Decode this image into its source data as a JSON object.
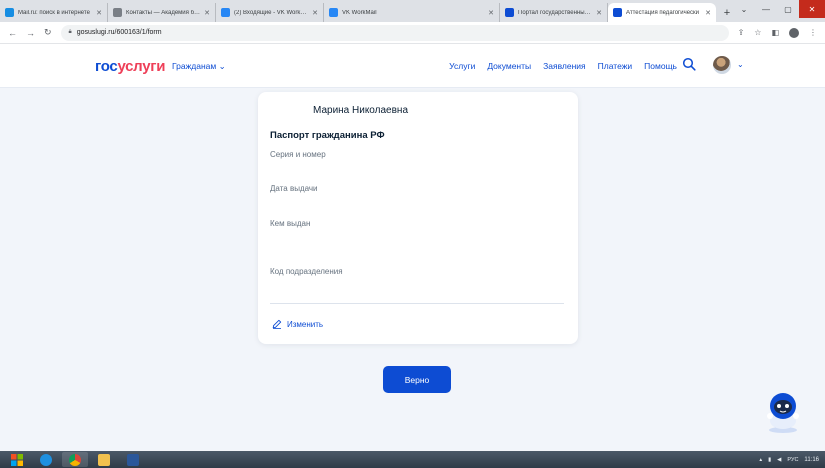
{
  "browser": {
    "tabs": [
      {
        "title": "Mail.ru: поиск в интернете",
        "favicon_color": "#168de2"
      },
      {
        "title": "Контакты — Академия бор",
        "favicon_color": "#7a7f86"
      },
      {
        "title": "(2) Входящие - VK WorkMail",
        "favicon_color": "#2787f5"
      },
      {
        "title": "VK WorkMail",
        "favicon_color": "#2787f5"
      },
      {
        "title": "Портал государственных у",
        "favicon_color": "#0d4cd3"
      },
      {
        "title": "Аттестация педагогически",
        "favicon_color": "#0d4cd3",
        "active": true
      }
    ],
    "new_tab_label": "+",
    "address": "gosuslugi.ru/600163/1/form"
  },
  "site": {
    "logo_part1": "гос",
    "logo_part2": "услуги",
    "audience_label": "Гражданам",
    "nav": [
      "Услуги",
      "Документы",
      "Заявления",
      "Платежи",
      "Помощь"
    ]
  },
  "card": {
    "full_name": "Марина Николаевна",
    "document_title": "Паспорт гражданина РФ",
    "fields": [
      {
        "label": "Серия и номер",
        "value": ""
      },
      {
        "label": "Дата выдачи",
        "value": ""
      },
      {
        "label": "Кем выдан",
        "value": ""
      },
      {
        "label": "Код подразделения",
        "value": ""
      }
    ],
    "edit_label": "Изменить"
  },
  "confirm_label": "Верно",
  "taskbar": {
    "clock": "11:16",
    "lang": "РУС"
  },
  "colors": {
    "brand_blue": "#0d4cd3",
    "brand_red": "#ee3f58",
    "page_bg": "#f2f5fa"
  }
}
